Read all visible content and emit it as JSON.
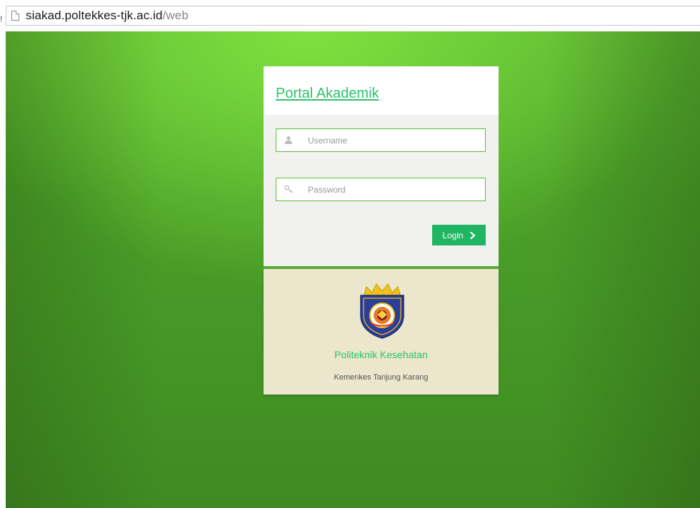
{
  "browser": {
    "edge_char": "!",
    "url_host": "siakad.poltekkes-tjk.ac.id",
    "url_path": "/web"
  },
  "login": {
    "title": "Portal Akademik",
    "username_placeholder": "Username",
    "password_placeholder": "Password",
    "button_label": "Login",
    "accent_color": "#2ac46a",
    "border_color": "#5fba39"
  },
  "institution": {
    "name": "Politeknik Kesehatan",
    "subtitle": "Kemenkes Tanjung Karang"
  },
  "icons": {
    "page": "page-icon",
    "user": "user-icon",
    "key": "key-icon",
    "chevron": "chevron-right-icon",
    "logo": "institution-logo"
  }
}
